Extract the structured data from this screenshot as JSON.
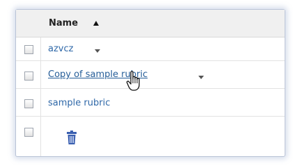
{
  "table": {
    "header": {
      "name_label": "Name",
      "sort_direction": "ascending",
      "sort_icon": "sort-ascending-icon"
    },
    "rows": [
      {
        "label": "azvcz",
        "has_dropdown": true,
        "checked": false
      },
      {
        "label": "Copy of sample rubric",
        "has_dropdown": true,
        "checked": false,
        "hovered": true
      },
      {
        "label": "sample rubric",
        "has_dropdown": false,
        "checked": false
      }
    ],
    "footer": {
      "checked": false,
      "action_icon": "trash-icon"
    }
  },
  "colors": {
    "link": "#2f68a8",
    "header_bg": "#f0f0f0",
    "border": "#b9c3d6",
    "trash": "#3a5fb0"
  },
  "cursor": {
    "type": "hand-pointer"
  }
}
